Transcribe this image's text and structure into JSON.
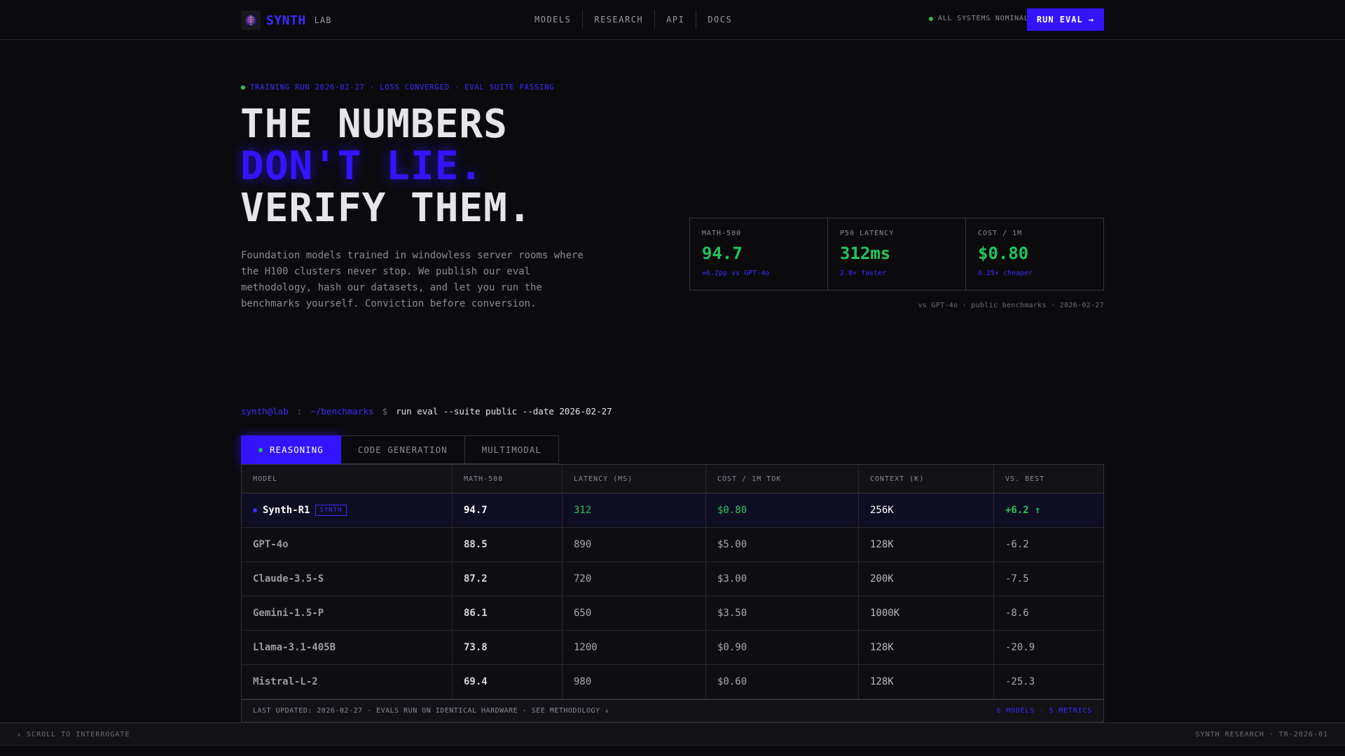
{
  "nav": {
    "brand": "SYNTH",
    "brand_sub": "LAB",
    "links": [
      "MODELS",
      "RESEARCH",
      "API",
      "DOCS"
    ],
    "status": "ALL SYSTEMS NOMINAL",
    "cta": "RUN EVAL →"
  },
  "hero": {
    "eyebrow": "TRAINING RUN 2026-02-27 · LOSS CONVERGED · EVAL SUITE PASSING",
    "headline": [
      "THE NUMBERS",
      "DON'T LIE.",
      "VERIFY THEM."
    ],
    "copy": "Foundation models trained in windowless server rooms where the H100 clusters never stop. We publish our eval methodology, hash our datasets, and let you run the benchmarks yourself. Conviction before conversion."
  },
  "metrics": [
    {
      "label": "MATH-500",
      "value": "94.7",
      "delta": "+6.2pp vs GPT-4o"
    },
    {
      "label": "P50 LATENCY",
      "value": "312ms",
      "delta": "2.8× faster"
    },
    {
      "label": "COST / 1M",
      "value": "$0.80",
      "delta": "6.25× cheaper"
    }
  ],
  "metrics_note": "vs GPT-4o · public benchmarks · 2026-02-27",
  "prompt": {
    "user": "synth@lab",
    "sep": ":",
    "path": "~/benchmarks",
    "dollar": "$",
    "command": "run eval --suite public --date 2026-02-27"
  },
  "tabs": [
    "REASONING",
    "CODE GENERATION",
    "MULTIMODAL"
  ],
  "table": {
    "headers": [
      "MODEL",
      "MATH-500",
      "LATENCY (MS)",
      "COST / 1M TOK",
      "CONTEXT (K)",
      "VS. BEST"
    ],
    "rows": [
      {
        "model": "Synth-R1",
        "badge": "SYNTH",
        "math": "94.7",
        "latency": "312",
        "cost": "$0.80",
        "context": "256K",
        "vs": "+6.2 ↑"
      },
      {
        "model": "GPT-4o",
        "math": "88.5",
        "latency": "890",
        "cost": "$5.00",
        "context": "128K",
        "vs": "-6.2"
      },
      {
        "model": "Claude-3.5-S",
        "math": "87.2",
        "latency": "720",
        "cost": "$3.00",
        "context": "200K",
        "vs": "-7.5"
      },
      {
        "model": "Gemini-1.5-P",
        "math": "86.1",
        "latency": "650",
        "cost": "$3.50",
        "context": "1000K",
        "vs": "-8.6"
      },
      {
        "model": "Llama-3.1-405B",
        "math": "73.8",
        "latency": "1200",
        "cost": "$0.90",
        "context": "128K",
        "vs": "-20.9"
      },
      {
        "model": "Mistral-L-2",
        "math": "69.4",
        "latency": "980",
        "cost": "$0.60",
        "context": "128K",
        "vs": "-25.3"
      }
    ],
    "footer_left": "LAST UPDATED: 2026-02-27 · EVALS RUN ON IDENTICAL HARDWARE · SEE METHODOLOGY ↓",
    "footer_right": "6 MODELS · 5 METRICS"
  },
  "bottom_bar": {
    "left": "↓ SCROLL TO INTERROGATE",
    "right": "SYNTH RESEARCH · TR-2026-01"
  },
  "colors": {
    "accent": "#3414ff",
    "positive": "#22c55e",
    "background": "#0b0b0e"
  }
}
